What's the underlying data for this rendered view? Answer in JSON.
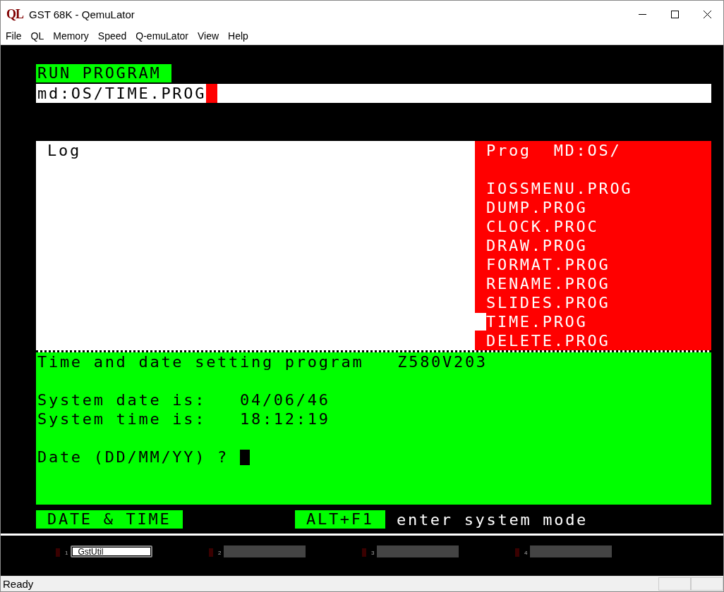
{
  "window": {
    "title": "GST 68K - QemuLator",
    "app_icon_text": "QL"
  },
  "menu": [
    {
      "label": "File"
    },
    {
      "label": "QL"
    },
    {
      "label": "Memory"
    },
    {
      "label": "Speed"
    },
    {
      "label": "Q-emuLator"
    },
    {
      "label": "View"
    },
    {
      "label": "Help"
    }
  ],
  "screen": {
    "header": "RUN PROGRAM",
    "command": {
      "value": "md:OS/TIME.PROG"
    },
    "log": {
      "title": "Log"
    },
    "prog": {
      "title": "Prog  MD:OS/",
      "items": [
        {
          "label": "IOSSMENU.PROG",
          "selected": false
        },
        {
          "label": "DUMP.PROG",
          "selected": false
        },
        {
          "label": "CLOCK.PROC",
          "selected": false
        },
        {
          "label": "DRAW.PROG",
          "selected": false
        },
        {
          "label": "FORMAT.PROG",
          "selected": false
        },
        {
          "label": "RENAME.PROG",
          "selected": false
        },
        {
          "label": "SLIDES.PROG",
          "selected": false
        },
        {
          "label": "TIME.PROG",
          "selected": true
        },
        {
          "label": "DELETE.PROG",
          "selected": false
        }
      ]
    },
    "console": {
      "heading": "Time and date setting program   Z580V203",
      "date_line": "System date is:   04/06/46",
      "time_line": "System time is:   18:12:19",
      "prompt": "Date (DD/MM/YY) ?"
    },
    "footer": {
      "title": "DATE & TIME",
      "key": "ALT+F1",
      "hint": "enter system mode"
    }
  },
  "taskbar": [
    {
      "number": "1",
      "label": "GstUtil",
      "selected": true
    },
    {
      "number": "2",
      "selected": false
    },
    {
      "number": "3",
      "selected": false
    },
    {
      "number": "4",
      "selected": false
    }
  ],
  "status_bar": {
    "text": "Ready"
  }
}
